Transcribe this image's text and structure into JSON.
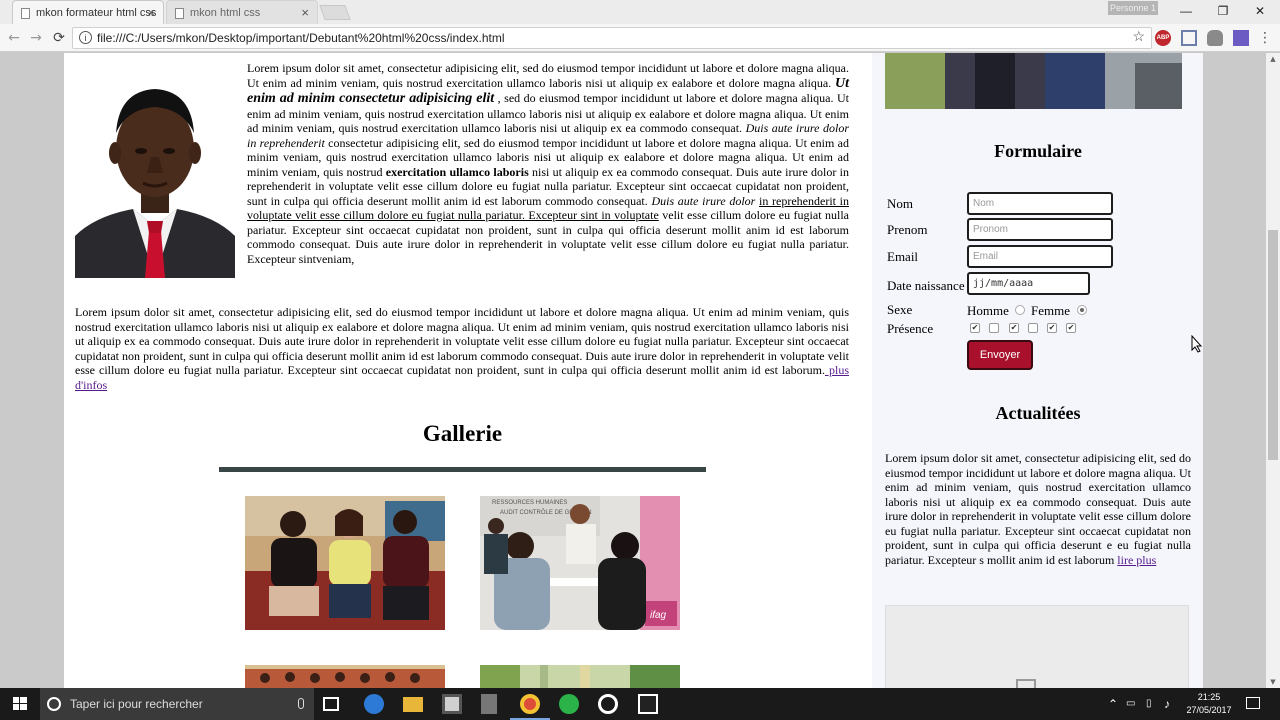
{
  "browser": {
    "tabs": [
      {
        "label": "mkon formateur html css",
        "close": "×"
      },
      {
        "label": "mkon html css",
        "close": "×"
      }
    ],
    "profile_label": "Personne 1",
    "window_buttons": {
      "minimize": "—",
      "restore": "❐",
      "close": "✕"
    },
    "nav": {
      "back": "←",
      "forward": "→",
      "reload": "⟳"
    },
    "address": "file:///C:/Users/mkon/Desktop/important/Debutant%20html%20css/index.html",
    "star": "☆",
    "menu": "⋮",
    "extensions": {
      "abp": "ABP"
    }
  },
  "page": {
    "intro": {
      "part1": "Lorem ipsum dolor sit amet, consectetur adipisicing elit, sed do eiusmod tempor incididunt ut labore et dolore magna aliqua. Ut enim ad minim veniam, quis nostrud exercitation ullamco laboris nisi ut aliquip ex ealabore et dolore magna aliqua. ",
      "emphasis": "Ut enim ad minim consectetur adipisicing elit",
      "part2": " , sed do eiusmod tempor incididunt ut labore et dolore magna aliqua. Ut enim ad minim veniam, quis nostrud exercitation ullamco laboris nisi ut aliquip ex ealabore et dolore magna aliqua. Ut enim ad minim veniam, quis nostrud exercitation ullamco laboris nisi ut aliquip ex ea commodo consequat. ",
      "italic1": "Duis aute irure dolor in reprehenderit",
      "part3": " consectetur adipisicing elit, sed do eiusmod tempor incididunt ut labore et dolore magna aliqua. Ut enim ad minim veniam, quis nostrud exercitation ullamco laboris nisi ut aliquip ex ealabore et dolore magna aliqua. Ut enim ad minim veniam, quis nostrud ",
      "bold": "exercitation ullamco laboris",
      "part4": " nisi ut aliquip ex ea commodo consequat. Duis aute irure dolor in reprehenderit in voluptate velit esse cillum dolore eu fugiat nulla pariatur. Excepteur sint occaecat cupidatat non proident, sunt in culpa qui officia deserunt mollit anim id est laborum commodo consequat. ",
      "italic2": "Duis aute irure dolor",
      "underlined": "in reprehenderit in voluptate velit esse cillum dolore eu fugiat nulla pariatur. Excepteur sint in voluptate",
      "part5": " velit esse cillum dolore eu fugiat nulla pariatur. Excepteur sint occaecat cupidatat non proident, sunt in culpa qui officia deserunt mollit anim id est laborum commodo consequat. Duis aute irure dolor in reprehenderit in voluptate velit esse cillum dolore eu fugiat nulla pariatur. Excepteur sintveniam,"
    },
    "second_paragraph": "Lorem ipsum dolor sit amet, consectetur adipisicing elit, sed do eiusmod tempor incididunt ut labore et dolore magna aliqua. Ut enim ad minim veniam, quis nostrud exercitation ullamco laboris nisi ut aliquip ex ealabore et dolore magna aliqua. Ut enim ad minim veniam, quis nostrud exercitation ullamco laboris nisi ut aliquip ex ea commodo consequat. Duis aute irure dolor in reprehenderit in voluptate velit esse cillum dolore eu fugiat nulla pariatur. Excepteur sint occaecat cupidatat non proident, sunt in culpa qui officia deserunt mollit anim id est laborum commodo consequat. Duis aute irure dolor in reprehenderit in voluptate velit esse cillum dolore eu fugiat nulla pariatur. Excepteur sint occaecat cupidatat non proident, sunt in culpa qui officia deserunt mollit anim id est laborum.",
    "more_link": " plus d'infos",
    "gallery_title": "Gallerie",
    "gallery_badge": "ifag",
    "gallery_sign_lines": [
      "RESSOURCES HUMAINES",
      "AUDIT CONTRÔLE DE GESTION"
    ]
  },
  "sidebar": {
    "form_title": "Formulaire",
    "fields": [
      {
        "label": "Nom",
        "placeholder": "Nom"
      },
      {
        "label": "Prenom",
        "placeholder": "Pronom"
      },
      {
        "label": "Email",
        "placeholder": "Email"
      },
      {
        "label": "Date naissance",
        "placeholder": "jj/mm/aaaa"
      }
    ],
    "sexe_label": "Sexe",
    "sexe_options": [
      "Homme",
      "Femme"
    ],
    "sexe_selected": "Femme",
    "presence_label": "Présence",
    "presence_checks": [
      true,
      false,
      true,
      false,
      true,
      true
    ],
    "submit_label": "Envoyer",
    "news_title": "Actualitées",
    "news_text": "Lorem ipsum dolor sit amet, consectetur adipisicing elit, sed do eiusmod tempor incididunt ut labore et dolore magna aliqua. Ut enim ad minim veniam, quis nostrud exercitation ullamco laboris nisi ut aliquip ex ea commodo consequat. Duis aute irure dolor in reprehenderit in voluptate velit esse cillum dolore eu fugiat nulla pariatur. Excepteur sint occaecat cupidatat non proident, sunt in culpa qui officia deserunt e eu fugiat nulla pariatur. Excepteur s mollit anim id est laborum",
    "news_link": "lire plus"
  },
  "taskbar": {
    "search_placeholder": "Taper ici pour rechercher",
    "time": "21:25",
    "date": "27/05/2017"
  },
  "colors": {
    "submit": "#a8102b",
    "sidebar_bg": "#f4f6fb",
    "gallery_rule": "#3a4545"
  }
}
